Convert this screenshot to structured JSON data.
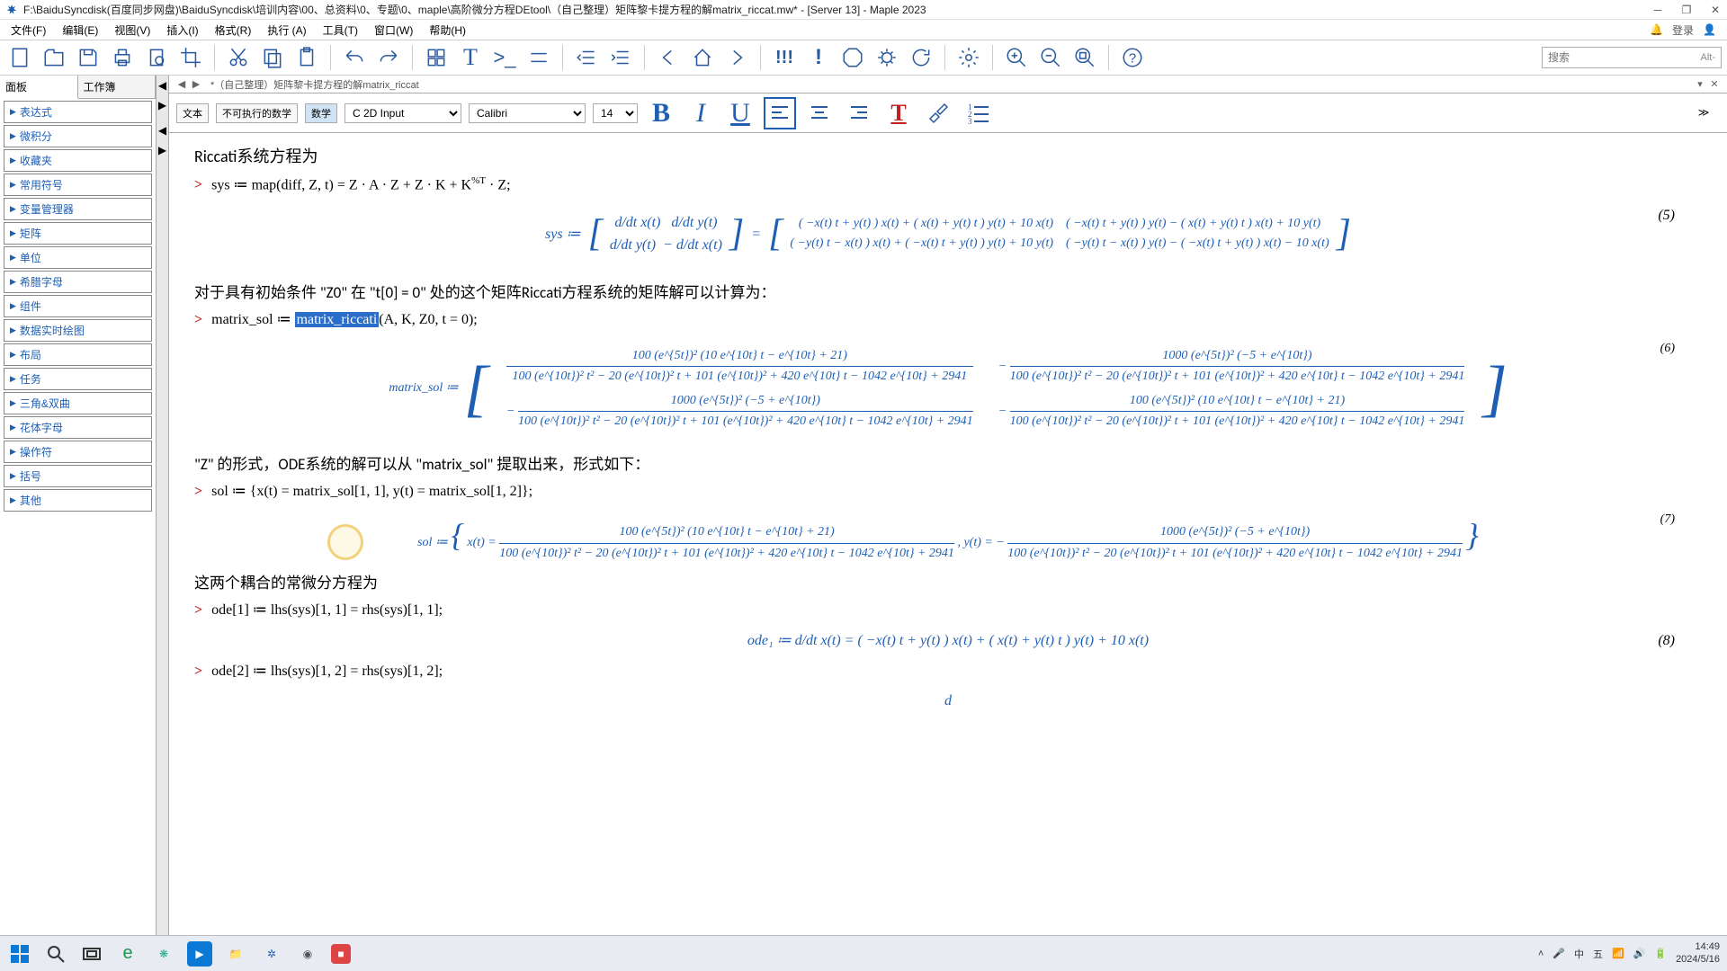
{
  "titlebar": {
    "path": "F:\\BaiduSyncdisk(百度同步网盘)\\BaiduSyncdisk\\培训内容\\00、总资料\\0、专题\\0、maple\\高阶微分方程DEtool\\（自己整理）矩阵黎卡提方程的解matrix_riccat.mw* - [Server 13] - Maple 2023"
  },
  "menu": {
    "items": [
      "文件(F)",
      "编辑(E)",
      "视图(V)",
      "插入(I)",
      "格式(R)",
      "执行 (A)",
      "工具(T)",
      "窗口(W)",
      "帮助(H)"
    ],
    "login": "登录"
  },
  "search": {
    "placeholder": "搜索",
    "hint": "Alt-"
  },
  "sidebar": {
    "tabs": [
      "面板",
      "工作簿"
    ],
    "items": [
      "表达式",
      "微积分",
      "收藏夹",
      "常用符号",
      "变量管理器",
      "矩阵",
      "单位",
      "希腊字母",
      "组件",
      "数据实时绘图",
      "布局",
      "任务",
      "三角&双曲",
      "花体字母",
      "操作符",
      "括号",
      "其他"
    ]
  },
  "doctab": {
    "name": "*（自己整理）矩阵黎卡提方程的解matrix_riccat"
  },
  "fmt": {
    "btn_text": "文本",
    "btn_math_nonexec": "不可执行的数学",
    "btn_math": "数学",
    "mode": "C 2D Input",
    "font": "Calibri",
    "size": "14"
  },
  "content": {
    "h1": "Riccati系统方程为",
    "line_sys_in": "sys ≔ map(diff, Z, t) = Z · A · Z + Z · K + K",
    "line_sys_in_tail": " · Z;",
    "sys_label": "sys ≔",
    "sys_lhs_11": "d/dt x(t)",
    "sys_lhs_12": "d/dt y(t)",
    "sys_lhs_21": "d/dt y(t)",
    "sys_lhs_22": "− d/dt x(t)",
    "sys_r11": "( −x(t) t + y(t) ) x(t) + ( x(t) + y(t) t ) y(t) + 10 x(t)",
    "sys_r12": "( −x(t) t + y(t) ) y(t) − ( x(t) + y(t) t ) x(t) + 10 y(t)",
    "sys_r21": "( −y(t) t − x(t) ) x(t) + ( −x(t) t + y(t) ) y(t) + 10 y(t)",
    "sys_r22": "( −y(t) t − x(t) ) y(t) − ( −x(t) t + y(t) ) x(t) − 10 x(t)",
    "eq5": "(5)",
    "p2": "对于具有初始条件 \"Z0\" 在 \"t[0] = 0\" 处的这个矩阵Riccati方程系统的矩阵解可以计算为：",
    "line_msol_in_pre": "matrix_sol ≔ ",
    "line_msol_hl": "matrix_riccati",
    "line_msol_in_post": "(A, K, Z0, t = 0);",
    "msol_label": "matrix_sol ≔",
    "num_a": "100 (e^{5t})² (10 e^{10t} t − e^{10t} + 21)",
    "num_b": "1000 (e^{5t})² (−5 + e^{10t})",
    "denom": "100 (e^{10t})² t² − 20 (e^{10t})² t + 101 (e^{10t})² + 420 e^{10t} t − 1042 e^{10t} + 2941",
    "eq6": "(6)",
    "p3": "\"Z\" 的形式，ODE系统的解可以从 \"matrix_sol\" 提取出来，形式如下：",
    "line_sol_in": "sol ≔ {x(t) = matrix_sol[1, 1], y(t) = matrix_sol[1, 2]};",
    "sol_label": "sol ≔",
    "sol_xt": "x(t) =",
    "sol_yt": ", y(t) = −",
    "eq7": "(7)",
    "p4": "这两个耦合的常微分方程为",
    "line_ode1_in": "ode[1] ≔ lhs(sys)[1, 1] = rhs(sys)[1, 1];",
    "ode1_out": "ode₁ ≔ d/dt x(t) = ( −x(t) t + y(t) ) x(t) + ( x(t) + y(t) t ) y(t) + 10 x(t)",
    "eq8": "(8)",
    "line_ode2_in": "ode[2] ≔ lhs(sys)[1, 2] = rhs(sys)[1, 2];"
  },
  "taskbar": {
    "time": "14:49",
    "date": "2024/5/16",
    "ime1": "中",
    "ime2": "五"
  }
}
